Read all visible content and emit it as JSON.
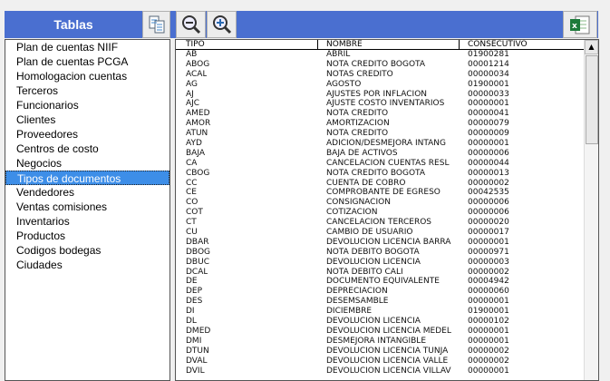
{
  "panel": {
    "title": "Tablas"
  },
  "icons": {
    "copy": "copy-document-icon",
    "zoom_out": "zoom-out-icon",
    "zoom_in": "zoom-in-icon",
    "excel": "excel-export-icon"
  },
  "colors": {
    "bar": "#4a6fd0",
    "selection": "#3d8ee8"
  },
  "tables": [
    "Plan de cuentas NIIF",
    "Plan de cuentas PCGA",
    "Homologacion cuentas",
    "Terceros",
    "Funcionarios",
    "Clientes",
    "Proveedores",
    "Centros de costo",
    "Negocios",
    "Tipos de documentos",
    "Vendedores",
    "Ventas comisiones",
    "Inventarios",
    "Productos",
    "Codigos bodegas",
    "Ciudades"
  ],
  "selected_table": "Tipos de documentos",
  "grid": {
    "headers": [
      "TIPO",
      "NOMBRE",
      "CONSECUTIVO"
    ],
    "rows": [
      [
        "AB",
        "ABRIL",
        "01900281"
      ],
      [
        "ABOG",
        "NOTA CREDITO BOGOTA",
        "00001214"
      ],
      [
        "ACAL",
        "NOTAS CREDITO",
        "00000034"
      ],
      [
        "AG",
        "AGOSTO",
        "01900001"
      ],
      [
        "AJ",
        "AJUSTES POR INFLACION",
        "00000033"
      ],
      [
        "AJC",
        "AJUSTE COSTO INVENTARIOS",
        "00000001"
      ],
      [
        "AMED",
        "NOTA CREDITO",
        "00000041"
      ],
      [
        "AMOR",
        "AMORTIZACIÓN",
        "00000079"
      ],
      [
        "ATUN",
        "NOTA CREDITO",
        "00000009"
      ],
      [
        "AYD",
        "ADICION/DESMEJORA INTANG",
        "00000001"
      ],
      [
        "BAJA",
        "BAJA DE ACTIVOS",
        "00000006"
      ],
      [
        "CA",
        "CANCELACION CUENTAS RESL",
        "00000044"
      ],
      [
        "CBOG",
        "NOTA CRÉDITO BOGOTÁ",
        "00000013"
      ],
      [
        "CC",
        "CUENTA DE COBRO",
        "00000002"
      ],
      [
        "CE",
        "COMPROBANTE DE EGRESO",
        "00042535"
      ],
      [
        "CO",
        "CONSIGNACION",
        "00000006"
      ],
      [
        "COT",
        "COTIZACIÓN",
        "00000006"
      ],
      [
        "CT",
        "CANCELACION TERCEROS",
        "00000020"
      ],
      [
        "CU",
        "CAMBIO DE USUARIO",
        "00000017"
      ],
      [
        "DBAR",
        "DEVOLUCION LICENCIA BARRA",
        "00000001"
      ],
      [
        "DBOG",
        "NOTA DEBITO BOGOTA",
        "00000971"
      ],
      [
        "DBUC",
        "DEVOLUCION LICENCIA",
        "00000003"
      ],
      [
        "DCAL",
        "NOTA DEBITO CALI",
        "00000002"
      ],
      [
        "DE",
        "DOCUMENTO EQUIVALENTE",
        "00004942"
      ],
      [
        "DEP",
        "DEPRECIACION",
        "00000060"
      ],
      [
        "DES",
        "DESEMSAMBLE",
        "00000001"
      ],
      [
        "DI",
        "DICIEMBRE",
        "01900001"
      ],
      [
        "DL",
        "DEVOLUCION LICENCIA",
        "00000102"
      ],
      [
        "DMED",
        "DEVOLUCION LICENCIA MEDEL",
        "00000001"
      ],
      [
        "DMI",
        "DESMEJORA INTANGIBLE",
        "00000001"
      ],
      [
        "DTUN",
        "DEVOLUCION LICENCIA TUNJA",
        "00000002"
      ],
      [
        "DVAL",
        "DEVOLUCION LICENCIA VALLE",
        "00000002"
      ],
      [
        "DVIL",
        "DEVOLUCION LICENCIA VILLAV",
        "00000001"
      ]
    ]
  }
}
